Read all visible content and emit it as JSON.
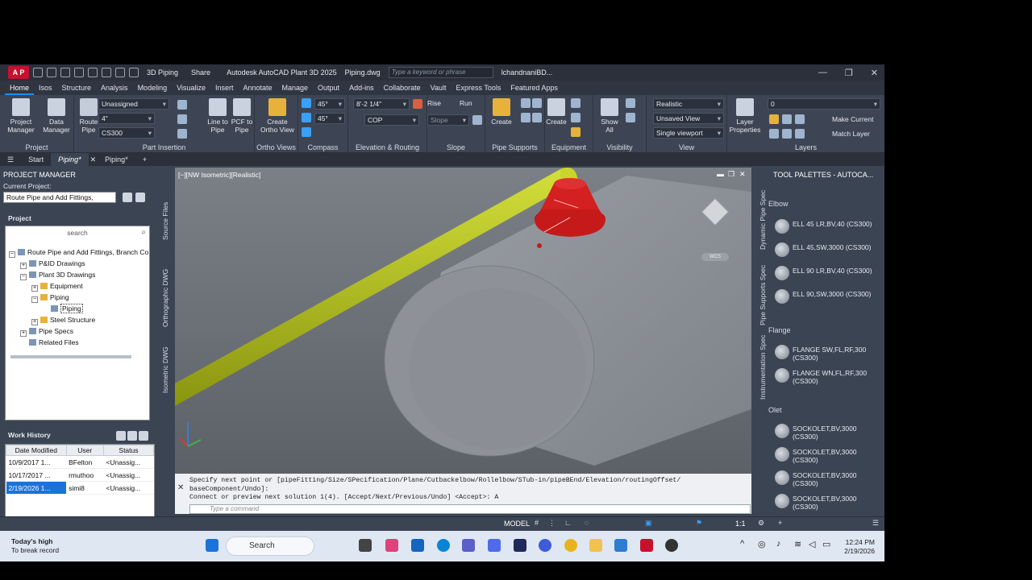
{
  "titlebar": {
    "workspace": "3D Piping",
    "share": "Share",
    "app_title": "Autodesk AutoCAD Plant 3D 2025",
    "file_name": "Piping.dwg",
    "search_placeholder": "Type a keyword or phrase",
    "user": "lchandnaniBD..."
  },
  "menu_tabs": [
    "Home",
    "Isos",
    "Structure",
    "Analysis",
    "Modeling",
    "Visualize",
    "Insert",
    "Annotate",
    "Manage",
    "Output",
    "Add-ins",
    "Collaborate",
    "Vault",
    "Express Tools",
    "Featured Apps"
  ],
  "ribbon": {
    "project": {
      "label": "Project",
      "pm": "Project\nManager",
      "dm": "Data\nManager"
    },
    "part_insertion": {
      "label": "Part Insertion",
      "route_pipe": "Route\nPipe",
      "unassigned": "Unassigned",
      "size": "4\"",
      "spec": "CS300",
      "line_to_pipe": "Line to\nPipe",
      "pcf_to_pipe": "PCF to\nPipe",
      "pcf": "PCF"
    },
    "ortho_views": {
      "label": "Ortho Views",
      "create": "Create\nOrtho View"
    },
    "compass": {
      "label": "Compass",
      "a1": "45°",
      "a2": "45°"
    },
    "elevation": {
      "label": "Elevation & Routing",
      "elev": "8'-2 1/4\"",
      "cop": "COP"
    },
    "slope": {
      "label": "Slope",
      "rise": "Rise",
      "run": "Run",
      "slope": "Slope"
    },
    "pipe_supports": {
      "label": "Pipe Supports",
      "create": "Create"
    },
    "equipment": {
      "label": "Equipment",
      "create": "Create"
    },
    "visibility": {
      "label": "Visibility",
      "show_all": "Show\nAll"
    },
    "view": {
      "label": "View",
      "style": "Realistic",
      "saved": "Unsaved View",
      "viewport": "Single viewport"
    },
    "layers": {
      "label": "Layers",
      "props": "Layer\nProperties",
      "make_current": "Make Current",
      "match_layer": "Match Layer",
      "layer": "0"
    }
  },
  "file_tabs": [
    "Start",
    "Piping*",
    "Piping*"
  ],
  "project_manager": {
    "title": "PROJECT MANAGER",
    "current_project_label": "Current Project:",
    "current_project": "Route Pipe and Add Fittings,",
    "project_label": "Project",
    "search": "search",
    "tree": [
      {
        "label": "Route Pipe and Add Fittings, Branch Co",
        "level": 0
      },
      {
        "label": "P&ID Drawings",
        "level": 1
      },
      {
        "label": "Plant 3D Drawings",
        "level": 1
      },
      {
        "label": "Equipment",
        "level": 2
      },
      {
        "label": "Piping",
        "level": 2
      },
      {
        "label": "Piping",
        "level": 3
      },
      {
        "label": "Steel Structure",
        "level": 2
      },
      {
        "label": "Pipe Specs",
        "level": 1
      },
      {
        "label": "Related Files",
        "level": 1
      }
    ],
    "vtabs": [
      "Source Files",
      "Orthographic DWG",
      "Isometric DWG"
    ]
  },
  "work_history": {
    "title": "Work History",
    "columns": [
      "Date Modified",
      "User",
      "Status"
    ],
    "rows": [
      [
        "10/9/2017 1...",
        "BFelton",
        "<Unassig..."
      ],
      [
        "10/17/2017 ...",
        "rmuthoo",
        "<Unassig..."
      ],
      [
        "2/19/2026 1...",
        "simi8",
        "<Unassig..."
      ]
    ]
  },
  "viewport": {
    "label": "[−][NW Isometric][Realistic]",
    "cube_label": "WCS"
  },
  "command": {
    "line1": "Specify next point or [pipeFitting/Size/SPecification/Plane/Cutbackelbow/Rollelbow/STub-in/pipeBEnd/Elevation/routingOffset/",
    "line2": "baseComponent/Undo]:",
    "line3": "Connect or preview next solution 1(4). [Accept/Next/Previous/Undo] <Accept>: A",
    "placeholder": "Type a command"
  },
  "tool_palettes": {
    "title": "TOOL PALETTES - AUTOCA...",
    "vtabs": [
      "Dynamic Pipe Spec",
      "Pipe Supports Spec",
      "Instrumentation Spec"
    ],
    "sections": [
      {
        "name": "Elbow",
        "items": [
          "ELL 45 LR,BV,40 (CS300)",
          "ELL 45,SW,3000 (CS300)",
          "ELL 90 LR,BV,40 (CS300)",
          "ELL 90,SW,3000 (CS300)"
        ]
      },
      {
        "name": "Flange",
        "items": [
          "FLANGE SW,FL,RF,300 (CS300)",
          "FLANGE WN,FL,RF,300 (CS300)"
        ]
      },
      {
        "name": "Olet",
        "items": [
          "SOCKOLET,BV,3000 (CS300)",
          "SOCKOLET,BV,3000 (CS300)",
          "SOCKOLET,BV,3000 (CS300)",
          "SOCKOLET,BV,3000 (CS300)"
        ]
      }
    ]
  },
  "statusbar": {
    "model": "MODEL",
    "scale": "1:1"
  },
  "taskbar": {
    "weather_title": "Today's high",
    "weather_sub": "To break record",
    "search": "Search",
    "time": "12:24 PM",
    "date": "2/19/2026"
  },
  "colors": {
    "pipe": "#b5c21a",
    "flange": "#d31e1e",
    "accent": "#1a8ef5"
  }
}
